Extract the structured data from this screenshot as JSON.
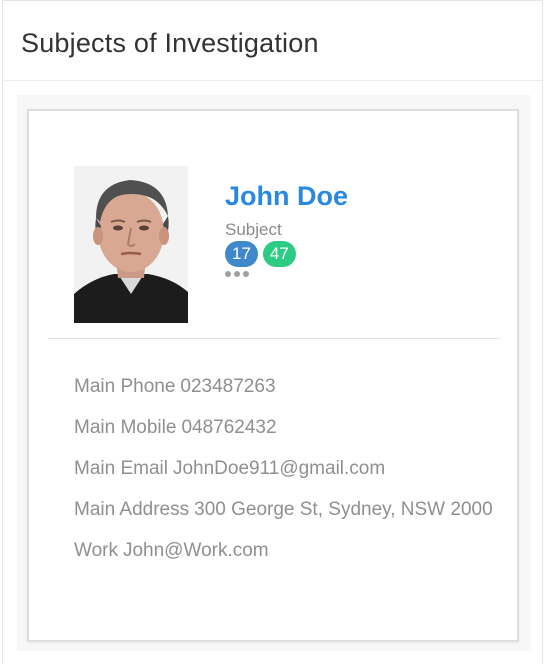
{
  "panel": {
    "title": "Subjects of Investigation"
  },
  "subject": {
    "name": "John Doe",
    "role": "Subject",
    "badges": [
      {
        "value": "17",
        "color": "#3f88c9"
      },
      {
        "value": "47",
        "color": "#2ecb85"
      }
    ],
    "more_icon": "ellipsis-icon",
    "photo_icon": "subject-photo"
  },
  "details": [
    {
      "label": "Main Phone",
      "value": "023487263"
    },
    {
      "label": "Main Mobile",
      "value": "048762432"
    },
    {
      "label": "Main Email",
      "value": "JohnDoe911@gmail.com"
    },
    {
      "label": "Main Address",
      "value": "300 George St, Sydney, NSW 2000"
    },
    {
      "label": "Work",
      "value": "John@Work.com"
    }
  ],
  "colors": {
    "name": "#2a88e0",
    "text_muted": "#8f8f8f",
    "badge_blue": "#3f88c9",
    "badge_green": "#2ecb85"
  }
}
